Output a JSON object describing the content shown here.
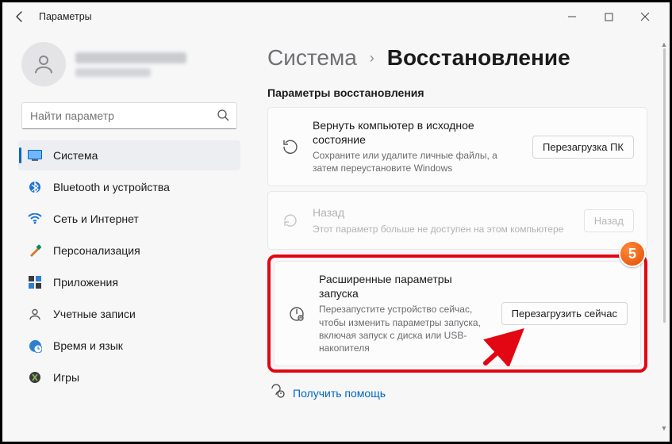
{
  "titlebar": {
    "title": "Параметры"
  },
  "search": {
    "placeholder": "Найти параметр"
  },
  "nav": {
    "items": [
      {
        "label": "Система"
      },
      {
        "label": "Bluetooth и устройства"
      },
      {
        "label": "Сеть и Интернет"
      },
      {
        "label": "Персонализация"
      },
      {
        "label": "Приложения"
      },
      {
        "label": "Учетные записи"
      },
      {
        "label": "Время и язык"
      },
      {
        "label": "Игры"
      }
    ]
  },
  "crumb": {
    "parent": "Система",
    "current": "Восстановление"
  },
  "section": {
    "title": "Параметры восстановления"
  },
  "cards": {
    "reset": {
      "title": "Вернуть компьютер в исходное состояние",
      "desc": "Сохраните или удалите личные файлы, а затем переустановите Windows",
      "button": "Перезагрузка ПК"
    },
    "goback": {
      "title": "Назад",
      "desc": "Этот параметр больше не доступен на этом компьютере",
      "button": "Назад"
    },
    "advanced": {
      "title": "Расширенные параметры запуска",
      "desc": "Перезапустите устройство сейчас, чтобы изменить параметры запуска, включая запуск с диска или USB-накопителя",
      "button": "Перезагрузить сейчас"
    }
  },
  "help": {
    "label": "Получить помощь"
  },
  "annotation": {
    "step": "5"
  }
}
